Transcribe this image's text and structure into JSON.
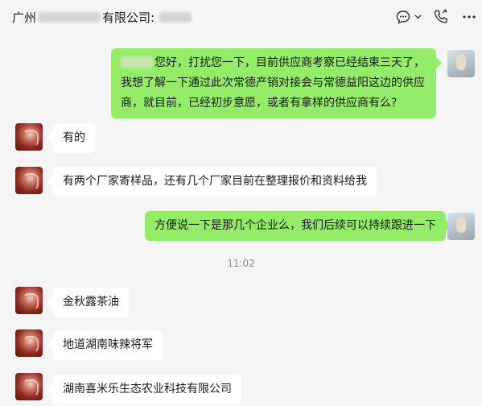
{
  "header": {
    "title_prefix": "广州",
    "title_mid": "有限公司:",
    "icons": [
      "message-bubble-icon",
      "chevron-down-icon",
      "phone-icon",
      "more-icon"
    ]
  },
  "messages": [
    {
      "side": "out",
      "text": "您好，打扰您一下，目前供应商考察已经结束三天了，我想了解一下通过此次常德产销对接会与常德益阳这边的供应商，就目前，已经初步意愿，或者有拿样的供应商有么?"
    },
    {
      "side": "in",
      "text": "有的"
    },
    {
      "side": "in",
      "text": "有两个厂家寄样品，还有几个厂家目前在整理报价和资料给我"
    },
    {
      "side": "out",
      "text": "方便说一下是那几个企业么，我们后续可以持续跟进一下"
    },
    {
      "side": "in",
      "text": "金秋露茶油"
    },
    {
      "side": "in",
      "text": "地道湖南味辣将军"
    },
    {
      "side": "in",
      "text": "湖南喜米乐生态农业科技有限公司"
    }
  ],
  "timestamp": "11:02",
  "colors": {
    "out_bubble": "#95ec69",
    "in_bubble": "#ffffff",
    "background": "#f5f5f5"
  }
}
